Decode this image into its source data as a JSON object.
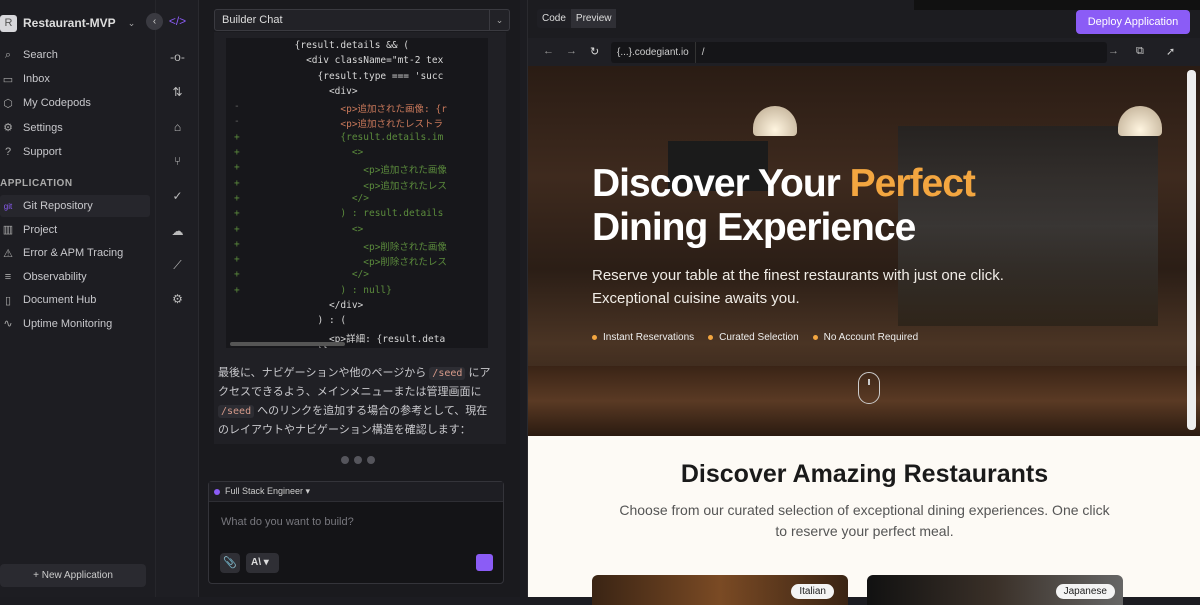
{
  "sidebar": {
    "avatar_letter": "R",
    "project": "Restaurant-MVP",
    "nav": [
      {
        "label": "Search",
        "icon": "⌕"
      },
      {
        "label": "Inbox",
        "icon": "▭"
      },
      {
        "label": "My Codepods",
        "icon": "⬡"
      },
      {
        "label": "Settings",
        "icon": "⚙"
      },
      {
        "label": "Support",
        "icon": "?"
      }
    ],
    "section": "APPLICATION",
    "app_nav": [
      {
        "label": "Git Repository",
        "icon": "git"
      },
      {
        "label": "Project",
        "icon": "▥"
      },
      {
        "label": "Error & APM Tracing",
        "icon": "⚠"
      },
      {
        "label": "Observability",
        "icon": "≡"
      },
      {
        "label": "Document Hub",
        "icon": "▯"
      },
      {
        "label": "Uptime Monitoring",
        "icon": "∿"
      }
    ],
    "new_app": "+ New Application"
  },
  "rail": [
    "</>",
    "-o-",
    "⇅",
    "⌂",
    "⑂",
    "✓",
    "☁",
    "⟋",
    "⚙"
  ],
  "chat": {
    "selector": "Builder Chat",
    "code": [
      {
        "m": "",
        "t": "            {result.details && (",
        "k": ""
      },
      {
        "m": "",
        "t": "              <div className=\"mt-2 tex",
        "k": ""
      },
      {
        "m": "",
        "t": "                {result.type === 'succ",
        "k": ""
      },
      {
        "m": "",
        "t": "                  <div>",
        "k": ""
      },
      {
        "m": "-",
        "t": "                    <p>追加された画像: {r",
        "k": "del"
      },
      {
        "m": "-",
        "t": "                    <p>追加されたレストラ",
        "k": "del"
      },
      {
        "m": "+",
        "t": "                    {result.details.im",
        "k": "add"
      },
      {
        "m": "+",
        "t": "                      <>",
        "k": "add"
      },
      {
        "m": "+",
        "t": "                        <p>追加された画像",
        "k": "add"
      },
      {
        "m": "+",
        "t": "                        <p>追加されたレス",
        "k": "add"
      },
      {
        "m": "+",
        "t": "                      </>",
        "k": "add"
      },
      {
        "m": "+",
        "t": "                    ) : result.details",
        "k": "add"
      },
      {
        "m": "+",
        "t": "                      <>",
        "k": "add"
      },
      {
        "m": "+",
        "t": "                        <p>削除された画像",
        "k": "add"
      },
      {
        "m": "+",
        "t": "                        <p>削除されたレス",
        "k": "add"
      },
      {
        "m": "+",
        "t": "                      </>",
        "k": "add"
      },
      {
        "m": "+",
        "t": "                    ) : null}",
        "k": "add"
      },
      {
        "m": "",
        "t": "                  </div>",
        "k": ""
      },
      {
        "m": "",
        "t": "                ) : (",
        "k": ""
      },
      {
        "m": "",
        "t": "                  <p>詳細: {result.deta",
        "k": ""
      },
      {
        "m": "",
        "t": "                )}",
        "k": ""
      }
    ],
    "message": {
      "p1": "最後に、ナビゲーションや他のページから ",
      "c1": "/seed",
      "p2": " にアクセスできるよう、メインメニューまたは管理画面に ",
      "c2": "/seed",
      "p3": " へのリンクを追加する場合の参考として、現在のレイアウトやナビゲーション構造を確認します："
    },
    "agent": "Full Stack Engineer ▾",
    "placeholder": "What do you want to build?",
    "model": "A\\ ▾"
  },
  "preview": {
    "tabs": [
      "Code",
      "Preview"
    ],
    "deploy": "Deploy Application",
    "host": "{...}.codegiant.io",
    "path": "/",
    "hero": {
      "title1": "Discover Your ",
      "accent": "Perfect",
      "title2": "Dining Experience",
      "sub1": "Reserve your table at the finest restaurants with just one click.",
      "sub2": "Exceptional cuisine awaits you.",
      "features": [
        "Instant Reservations",
        "Curated Selection",
        "No Account Required"
      ]
    },
    "section": {
      "title": "Discover Amazing Restaurants",
      "desc": "Choose from our curated selection of exceptional dining experiences. One click to reserve your perfect meal."
    },
    "cards": [
      "Italian",
      "Japanese"
    ]
  },
  "colors": {
    "accent": "#8b5cf6",
    "hero_accent": "#f3a640"
  }
}
